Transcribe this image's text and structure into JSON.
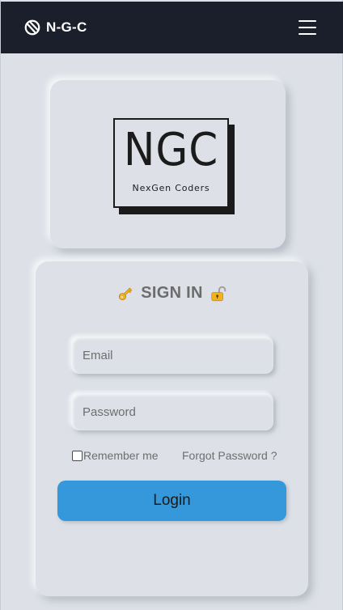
{
  "navbar": {
    "brand": "N-G-C",
    "brand_icon": "spinner-logo-icon",
    "menu_icon": "hamburger-menu-icon"
  },
  "logo": {
    "main_text": "NGC",
    "sub_text": "NexGen Coders"
  },
  "signin": {
    "title": "SIGN IN",
    "left_icon": "key-icon",
    "right_icon": "unlocked-padlock-icon",
    "email_placeholder": "Email",
    "password_placeholder": "Password",
    "remember_label": "Remember me",
    "remember_checked": false,
    "forgot_label": "Forgot Password ?",
    "login_label": "Login"
  },
  "colors": {
    "background": "#dde1e7",
    "navbar": "#1b1f2b",
    "button": "#3498db",
    "icon_gold": "#f2b21d"
  }
}
